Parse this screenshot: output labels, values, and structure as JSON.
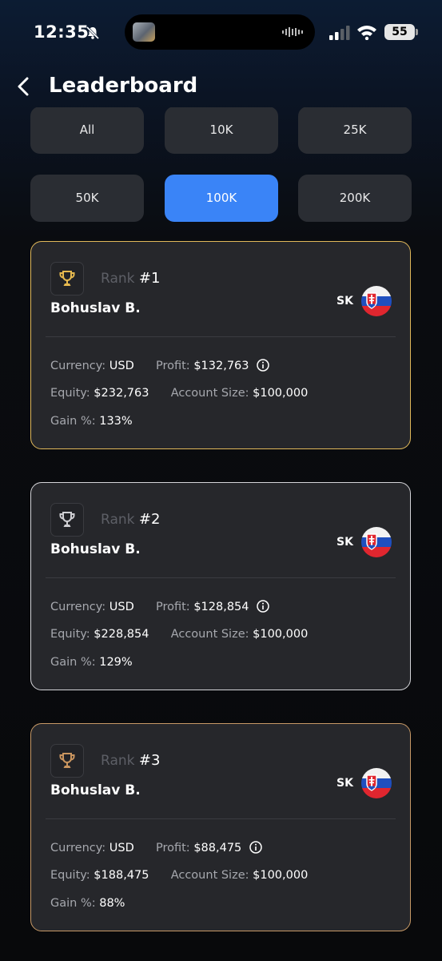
{
  "status_bar": {
    "time": "12:35",
    "battery": "55"
  },
  "header": {
    "title": "Leaderboard"
  },
  "filters": [
    "All",
    "10K",
    "25K",
    "50K",
    "100K",
    "200K"
  ],
  "active_filter": "100K",
  "labels": {
    "rank": "Rank",
    "currency": "Currency:",
    "profit": "Profit:",
    "equity": "Equity:",
    "account_size": "Account Size:",
    "gain": "Gain %:"
  },
  "entries": [
    {
      "rank": "#1",
      "name": "Bohuslav B.",
      "country": "SK",
      "currency": "USD",
      "profit": "$132,763",
      "equity": "$232,763",
      "account_size": "$100,000",
      "gain": "133%"
    },
    {
      "rank": "#2",
      "name": "Bohuslav B.",
      "country": "SK",
      "currency": "USD",
      "profit": "$128,854",
      "equity": "$228,854",
      "account_size": "$100,000",
      "gain": "129%"
    },
    {
      "rank": "#3",
      "name": "Bohuslav B.",
      "country": "SK",
      "currency": "USD",
      "profit": "$88,475",
      "equity": "$188,475",
      "account_size": "$100,000",
      "gain": "88%"
    }
  ],
  "colors": {
    "accent": "#3a84f7",
    "gold": "#e0b85a",
    "silver": "#d4d4d8",
    "bronze": "#c79966"
  }
}
